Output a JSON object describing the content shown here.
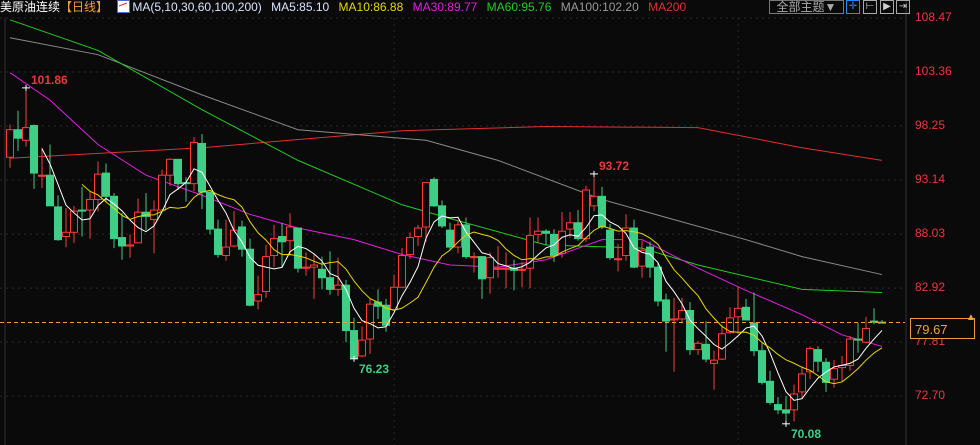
{
  "header": {
    "symbol": "美原油连续",
    "period": "【日线】",
    "ma_params": "MA(5,10,30,60,100,200)",
    "ma5": "MA5:85.10",
    "ma10": "MA10:86.88",
    "ma30": "MA30:89.77",
    "ma60": "MA60:95.76",
    "ma100": "MA100:102.20",
    "ma200": "MA200"
  },
  "toolbar": {
    "theme": "全部主题▼"
  },
  "axis": {
    "ticks": [
      "108.47",
      "103.36",
      "98.25",
      "93.14",
      "88.03",
      "82.92",
      "77.81",
      "72.70"
    ]
  },
  "last_price": "79.67",
  "annotations": {
    "high1": "101.86",
    "high2": "93.72",
    "low1": "76.23",
    "low2": "70.08"
  },
  "colors": {
    "up": "#ff3b3b",
    "down": "#3dcf85",
    "ma5": "#ffffff",
    "ma10": "#e6d700",
    "ma30": "#e020e0",
    "ma60": "#22cc22",
    "ma100": "#8a8a8a",
    "ma200": "#e03030",
    "last": "#f0a040"
  },
  "chart_data": {
    "type": "candlestick",
    "ylim": [
      68.5,
      110.5
    ],
    "candles": [
      [
        95.3,
        98.4,
        94.3,
        97.9
      ],
      [
        97.9,
        99.7,
        95.9,
        97.1
      ],
      [
        96.9,
        101.86,
        96.3,
        98.1
      ],
      [
        98.3,
        98.4,
        92.3,
        93.8
      ],
      [
        93.5,
        96.2,
        92.4,
        93.6
      ],
      [
        93.6,
        96.5,
        90.7,
        90.7
      ],
      [
        90.6,
        91.7,
        87.4,
        87.5
      ],
      [
        87.8,
        90.5,
        86.8,
        88.2
      ],
      [
        88.2,
        90.7,
        87.2,
        90.2
      ],
      [
        90.3,
        92.5,
        87.8,
        90.2
      ],
      [
        90.3,
        92.1,
        87.6,
        91.3
      ],
      [
        91.3,
        94.9,
        90.2,
        93.7
      ],
      [
        93.8,
        94.7,
        91.1,
        91.6
      ],
      [
        91.6,
        91.9,
        86.7,
        87.6
      ],
      [
        87.7,
        90.0,
        85.6,
        86.9
      ],
      [
        86.9,
        88.0,
        85.8,
        87.0
      ],
      [
        87.2,
        91.4,
        87.2,
        90.1
      ],
      [
        90.1,
        91.9,
        88.4,
        89.7
      ],
      [
        89.4,
        91.2,
        86.2,
        90.3
      ],
      [
        90.3,
        94.1,
        90.1,
        93.6
      ],
      [
        93.6,
        95.2,
        92.6,
        95.1
      ],
      [
        95.1,
        95.1,
        92.2,
        92.8
      ],
      [
        92.9,
        93.4,
        91.1,
        92.8
      ],
      [
        92.8,
        97.2,
        92.1,
        96.7
      ],
      [
        96.6,
        97.5,
        90.4,
        92.0
      ],
      [
        92.0,
        92.0,
        88.0,
        88.5
      ],
      [
        88.5,
        89.4,
        85.8,
        86.1
      ],
      [
        86.0,
        89.4,
        85.5,
        86.8
      ],
      [
        86.9,
        90.2,
        86.8,
        88.4
      ],
      [
        88.7,
        89.3,
        85.9,
        86.6
      ],
      [
        86.6,
        87.6,
        81.2,
        81.3
      ],
      [
        81.7,
        84.1,
        80.9,
        82.3
      ],
      [
        82.6,
        87.0,
        82.0,
        85.9
      ],
      [
        86.0,
        88.9,
        84.9,
        87.6
      ],
      [
        87.8,
        89.1,
        84.9,
        87.3
      ],
      [
        87.4,
        90.0,
        86.0,
        88.7
      ],
      [
        88.6,
        88.6,
        84.4,
        84.8
      ],
      [
        84.8,
        86.3,
        84.1,
        84.9
      ],
      [
        84.9,
        86.1,
        81.9,
        85.1
      ],
      [
        84.7,
        85.9,
        82.8,
        83.9
      ],
      [
        83.9,
        86.4,
        82.3,
        82.8
      ],
      [
        82.8,
        85.8,
        82.2,
        83.2
      ],
      [
        83.2,
        83.7,
        77.8,
        78.9
      ],
      [
        78.9,
        80.1,
        76.23,
        76.3
      ],
      [
        76.5,
        79.3,
        76.4,
        78.0
      ],
      [
        78.1,
        81.9,
        76.7,
        81.4
      ],
      [
        81.6,
        82.8,
        80.0,
        81.2
      ],
      [
        81.3,
        81.9,
        78.8,
        79.4
      ],
      [
        80.9,
        84.2,
        80.9,
        83.0
      ],
      [
        83.0,
        86.7,
        83.0,
        86.0
      ],
      [
        86.1,
        88.2,
        85.7,
        87.7
      ],
      [
        87.8,
        88.9,
        86.9,
        88.6
      ],
      [
        88.7,
        92.9,
        87.3,
        92.9
      ],
      [
        93.2,
        93.4,
        90.6,
        90.7
      ],
      [
        90.7,
        91.2,
        88.6,
        88.8
      ],
      [
        88.4,
        89.1,
        86.5,
        86.8
      ],
      [
        86.8,
        89.4,
        86.2,
        88.9
      ],
      [
        88.9,
        89.6,
        85.7,
        85.9
      ],
      [
        85.8,
        86.3,
        84.4,
        85.9
      ],
      [
        85.9,
        85.9,
        81.9,
        83.8
      ],
      [
        83.9,
        86.3,
        82.4,
        85.8
      ],
      [
        84.7,
        86.9,
        83.9,
        84.8
      ],
      [
        84.7,
        86.3,
        82.9,
        84.8
      ],
      [
        84.8,
        85.6,
        82.7,
        84.6
      ],
      [
        84.6,
        85.4,
        83.0,
        84.7
      ],
      [
        84.8,
        89.6,
        82.9,
        87.9
      ],
      [
        88.0,
        89.6,
        87.2,
        88.3
      ],
      [
        88.3,
        88.5,
        87.0,
        88.1
      ],
      [
        88.0,
        88.5,
        85.4,
        86.0
      ],
      [
        86.2,
        90.1,
        85.8,
        88.3
      ],
      [
        88.5,
        90.1,
        87.7,
        89.1
      ],
      [
        89.1,
        90.3,
        87.4,
        87.6
      ],
      [
        87.6,
        92.6,
        87.3,
        92.2
      ],
      [
        90.7,
        93.72,
        90.2,
        91.6
      ],
      [
        91.6,
        92.5,
        88.5,
        88.7
      ],
      [
        88.4,
        89.0,
        85.6,
        85.8
      ],
      [
        85.6,
        87.1,
        84.5,
        85.7
      ],
      [
        86.0,
        89.9,
        85.5,
        88.6
      ],
      [
        88.6,
        89.4,
        84.8,
        84.9
      ],
      [
        85.0,
        87.4,
        83.9,
        86.5
      ],
      [
        86.8,
        87.3,
        83.9,
        84.9
      ],
      [
        84.9,
        85.3,
        81.2,
        81.7
      ],
      [
        81.8,
        82.4,
        76.9,
        79.8
      ],
      [
        79.9,
        82.0,
        75.0,
        80.0
      ],
      [
        80.0,
        82.0,
        79.6,
        80.8
      ],
      [
        80.8,
        81.6,
        76.6,
        77.1
      ],
      [
        77.1,
        77.9,
        76.6,
        77.7
      ],
      [
        77.6,
        79.8,
        75.9,
        76.2
      ],
      [
        75.8,
        77.0,
        73.3,
        76.1
      ],
      [
        76.2,
        79.4,
        76.1,
        78.6
      ],
      [
        78.7,
        81.1,
        78.6,
        80.1
      ],
      [
        80.2,
        83.1,
        78.6,
        81.0
      ],
      [
        81.1,
        81.9,
        79.9,
        79.9
      ],
      [
        79.6,
        82.5,
        76.5,
        77.0
      ],
      [
        77.0,
        77.7,
        73.8,
        74.0
      ],
      [
        74.1,
        75.1,
        71.9,
        72.1
      ],
      [
        71.9,
        72.6,
        71.0,
        71.4
      ],
      [
        71.4,
        72.7,
        70.08,
        71.1
      ],
      [
        71.4,
        73.8,
        70.3,
        72.9
      ],
      [
        73.1,
        75.5,
        72.5,
        74.8
      ],
      [
        75.0,
        77.4,
        74.3,
        77.2
      ],
      [
        77.1,
        77.4,
        75.0,
        76.0
      ],
      [
        75.9,
        76.3,
        73.1,
        74.0
      ],
      [
        74.3,
        76.1,
        73.5,
        75.3
      ],
      [
        75.4,
        76.5,
        74.1,
        75.6
      ],
      [
        75.6,
        78.4,
        75.1,
        78.1
      ],
      [
        78.1,
        79.6,
        76.8,
        78.0
      ],
      [
        77.8,
        80.2,
        77.7,
        79.1
      ],
      [
        79.8,
        81.0,
        79.5,
        79.7
      ],
      [
        79.7,
        79.9,
        79.6,
        79.67
      ]
    ],
    "ma_lines": {
      "ma30": [
        [
          0,
          103.3
        ],
        [
          5,
          100.7
        ],
        [
          11,
          96.5
        ],
        [
          17,
          93.6
        ],
        [
          24,
          91.7
        ],
        [
          30,
          89.9
        ],
        [
          36,
          88.6
        ],
        [
          43,
          87.5
        ],
        [
          49,
          86.1
        ],
        [
          55,
          85.1
        ],
        [
          61,
          84.9
        ],
        [
          67,
          85.6
        ],
        [
          74,
          87.5
        ],
        [
          79,
          87.5
        ],
        [
          86,
          84.8
        ],
        [
          92,
          82.7
        ],
        [
          99,
          80.4
        ],
        [
          104,
          78.5
        ],
        [
          109,
          77.4
        ]
      ],
      "ma60": [
        [
          0,
          108.3
        ],
        [
          11,
          105.4
        ],
        [
          24,
          99.8
        ],
        [
          36,
          95.0
        ],
        [
          49,
          90.8
        ],
        [
          55,
          89.5
        ],
        [
          67,
          87.0
        ],
        [
          79,
          86.7
        ],
        [
          86,
          85.1
        ],
        [
          99,
          82.8
        ],
        [
          109,
          82.5
        ]
      ],
      "ma100": [
        [
          0,
          106.6
        ],
        [
          11,
          105.0
        ],
        [
          24,
          101.2
        ],
        [
          36,
          97.9
        ],
        [
          52,
          96.9
        ],
        [
          61,
          95.0
        ],
        [
          74,
          91.3
        ],
        [
          83,
          89.4
        ],
        [
          92,
          87.5
        ],
        [
          99,
          85.9
        ],
        [
          109,
          84.2
        ]
      ],
      "ma200": [
        [
          0,
          95.2
        ],
        [
          24,
          96.2
        ],
        [
          49,
          97.8
        ],
        [
          67,
          98.2
        ],
        [
          86,
          98.1
        ],
        [
          99,
          96.2
        ],
        [
          109,
          95.0
        ]
      ]
    }
  }
}
